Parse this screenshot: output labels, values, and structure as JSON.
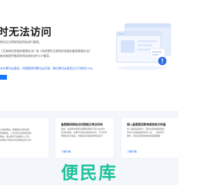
{
  "page": {
    "title": "时无法访问",
    "lines": [
      "原站无法获取到此网站进行备案。",
      "《互联网信息服务管理办法》和《非经营性互联网信息服务备案管理办法》",
      "者未能提供备案的网站域名进行ICP备案。",
      ""
    ],
    "notice": "未在腾讯云备案，如需要使用腾讯云资源，需在腾讯云备案后方可使用CDN。"
  },
  "cards": [
    {
      "title": "",
      "lines": [
        "户备案网站，根据相关法律法规",
        "所需备案，上号证件后注册经营等",
        "网站，需从腾讯云的相关入口对",
        "处理后不能通过关闭网络进行访问"
      ],
      "link": ""
    },
    {
      "title": "备案期间网站访问限制正常访问吗",
      "lines": [
        "备案，在备案的审核过程期间网站不得上线访问",
        "还请在备案，在腾讯云提交备案信息时，不可访问",
        "网网站访问备案，未备案请请备案的网站来可"
      ],
      "link": "了解详情"
    },
    {
      "title": "接入备案是否影响其他地方的备",
      "lines": [
        "接入备案是指用户，若您在其他备案服务",
        "务中心有备案指导新增入住，，请是用于",
        "服务，若您无需到其他提供部需要备"
      ],
      "link": "了解详情"
    }
  ],
  "watermark": "便民库",
  "colors": {
    "accent": "#1677ff",
    "notice": "#2f6fe6",
    "watermark": "#1ec39a",
    "bottom_bg": "#f3f6fb"
  }
}
